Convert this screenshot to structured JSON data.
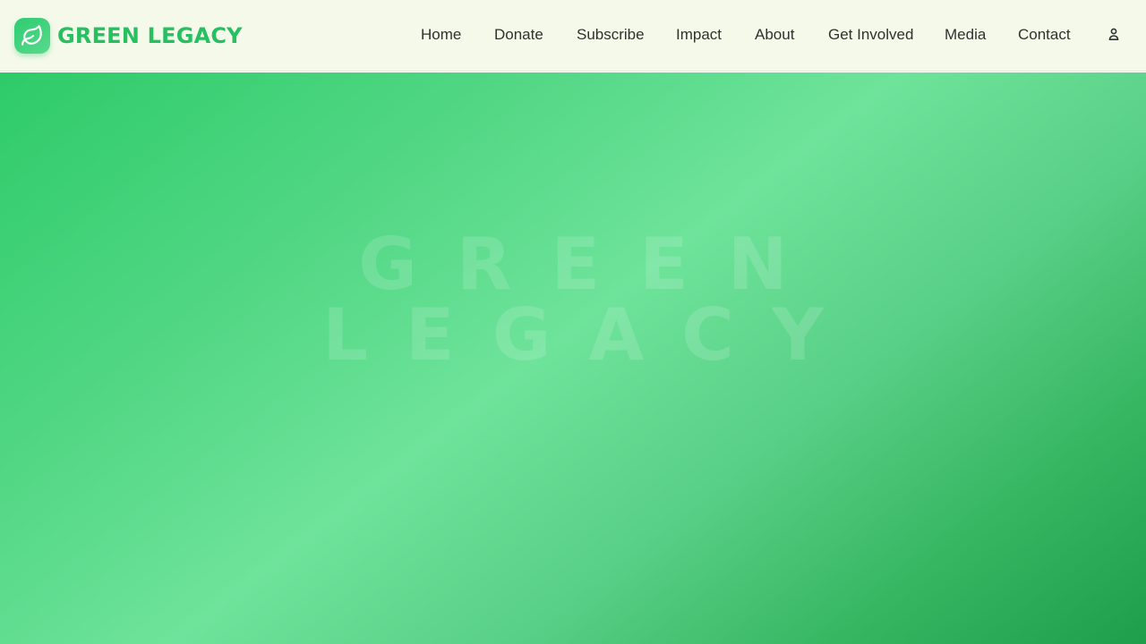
{
  "brand": {
    "name": "GREEN LEGACY",
    "logo_icon": "leaf-icon"
  },
  "nav": {
    "items": [
      {
        "label": "Home"
      },
      {
        "label": "Donate"
      },
      {
        "label": "Subscribe"
      },
      {
        "label": "Impact"
      },
      {
        "label": "About"
      },
      {
        "label": "Get Involved"
      },
      {
        "label": "Media"
      },
      {
        "label": "Contact"
      }
    ],
    "account_icon": "user-icon"
  },
  "hero": {
    "watermark_line1": "GREEN",
    "watermark_line2": "LEGACY"
  },
  "colors": {
    "brand_green": "#27c061",
    "nav_background": "#f5f9ea",
    "nav_text": "#2d332e",
    "hero_gradient_start": "#2ecb69",
    "hero_gradient_mid": "#6ee39a",
    "hero_gradient_end": "#1e9e4b"
  }
}
